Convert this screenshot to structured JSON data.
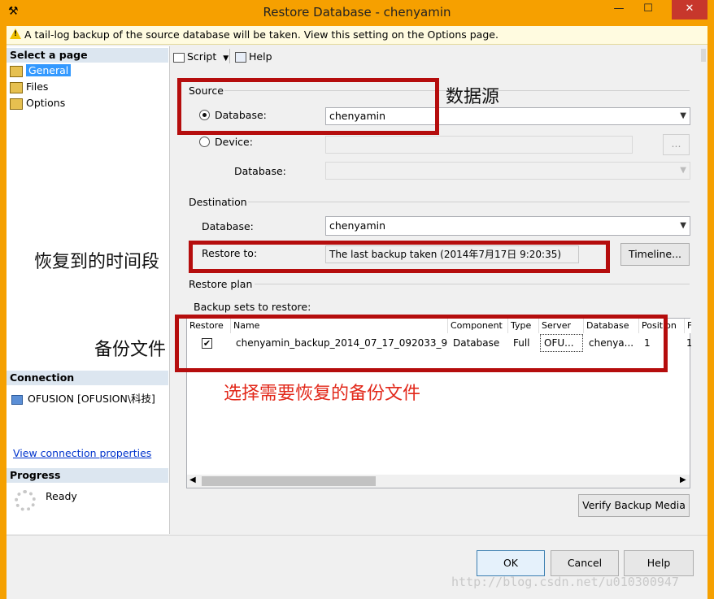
{
  "window": {
    "title": "Restore Database - chenyamin",
    "minimize": "—",
    "maximize": "☐",
    "close": "✕"
  },
  "warning": {
    "text": "A tail-log backup of the source database will be taken. View this setting on the Options page."
  },
  "left": {
    "select_page": "Select a page",
    "pages": [
      "General",
      "Files",
      "Options"
    ],
    "connection_header": "Connection",
    "connection_value": "OFUSION [OFUSION\\科技]",
    "view_connection": "View connection properties",
    "progress_header": "Progress",
    "progress_status": "Ready"
  },
  "toolbar": {
    "script": "Script",
    "help": "Help"
  },
  "source": {
    "header": "Source",
    "database_radio": "Database:",
    "database_value": "chenyamin",
    "device_radio": "Device:",
    "device_browse": "...",
    "device_database_label": "Database:"
  },
  "destination": {
    "header": "Destination",
    "database_label": "Database:",
    "database_value": "chenyamin",
    "restore_to_label": "Restore to:",
    "restore_to_value": "The last backup taken (2014年7月17日 9:20:35)",
    "timeline_button": "Timeline..."
  },
  "restore_plan": {
    "header": "Restore plan",
    "backup_sets_label": "Backup sets to restore:",
    "columns": [
      "Restore",
      "Name",
      "Component",
      "Type",
      "Server",
      "Database",
      "Position",
      "F"
    ],
    "rows": [
      {
        "restore": "✔",
        "name": "chenyamin_backup_2014_07_17_092033_9...",
        "component": "Database",
        "type": "Full",
        "server": "OFU...",
        "database": "chenya...",
        "position": "1",
        "extra": "1"
      }
    ],
    "verify_button": "Verify Backup Media"
  },
  "footer": {
    "ok": "OK",
    "cancel": "Cancel",
    "help": "Help"
  },
  "annotations": {
    "data_source": "数据源",
    "restore_time": "恢复到的时间段",
    "backup_file": "备份文件",
    "select_backup": "选择需要恢复的备份文件"
  },
  "watermark": "http://blog.csdn.net/u010300947"
}
